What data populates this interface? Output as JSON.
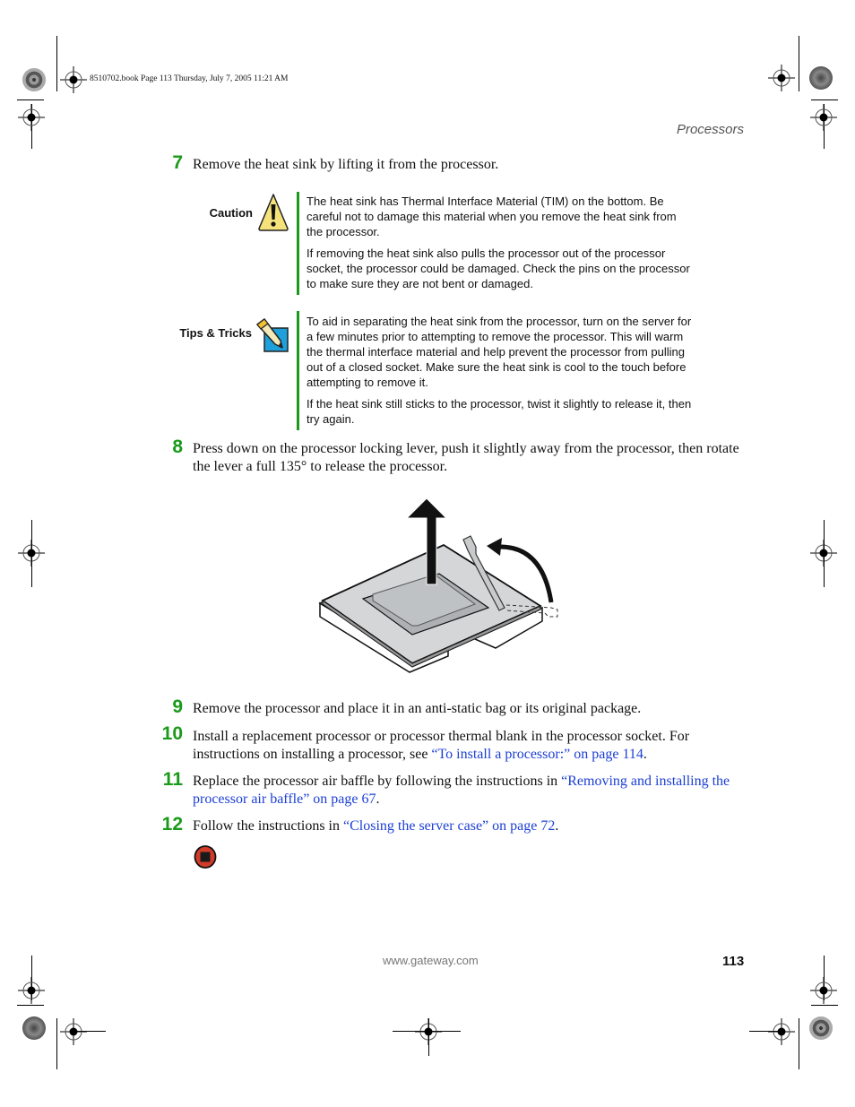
{
  "slug": "8510702.book  Page 113  Thursday, July 7, 2005  11:21 AM",
  "running_head": "Processors",
  "steps": [
    {
      "number": "7",
      "text": "Remove the heat sink by lifting it from the processor."
    },
    {
      "number": "8",
      "text": "Press down on the processor locking lever, push it slightly away from the processor, then rotate the lever a full 135° to release the processor."
    },
    {
      "number": "9",
      "text": "Remove the processor and place it in an anti-static bag or its original package."
    },
    {
      "number": "10",
      "text_before": "Install a replacement processor or processor thermal blank in the processor socket. For instructions on installing a processor, see ",
      "link": "“To install a processor:” on page 114",
      "text_after": "."
    },
    {
      "number": "11",
      "text_before": "Replace the processor air baffle by following the instructions in ",
      "link": "“Removing and installing the processor air baffle” on page 67",
      "text_after": "."
    },
    {
      "number": "12",
      "text_before": "Follow the instructions in ",
      "link": "“Closing the server case” on page 72",
      "text_after": "."
    }
  ],
  "caution": {
    "label": "Caution",
    "icon": "warning-triangle-icon",
    "paragraphs": [
      "The heat sink has Thermal Interface Material (TIM) on the bottom. Be careful not to damage this material when you remove the heat sink from the processor.",
      "If removing the heat sink also pulls the processor out of the processor socket, the processor could be damaged. Check the pins on the processor to make sure they are not bent or damaged."
    ]
  },
  "tips": {
    "label": "Tips & Tricks",
    "icon": "pencil-icon",
    "paragraphs": [
      "To aid in separating the heat sink from the processor, turn on the server for a few minutes prior to attempting to remove the processor. This will warm the thermal interface material and help prevent the processor from pulling out of a closed socket. Make sure the heat sink is cool to the touch before attempting to remove it.",
      "If the heat sink still sticks to the processor, twist it slightly to release it, then try again."
    ]
  },
  "illustration": {
    "description": "Processor being lifted from socket with locking lever rotated open",
    "icons": [
      "up-arrow-icon",
      "rotate-arrow-icon"
    ]
  },
  "end_icon": "stop-icon",
  "footer": {
    "url": "www.gateway.com",
    "page_number": "113"
  },
  "colors": {
    "step_number": "#1a9a1a",
    "note_bar": "#1a9a1a",
    "link": "#1c3fd4",
    "running_head": "#555555",
    "footer_url": "#777777",
    "warning_fill": "#f5e27a",
    "tips_blue": "#1ea0dc",
    "stop_red": "#d23a2a"
  }
}
